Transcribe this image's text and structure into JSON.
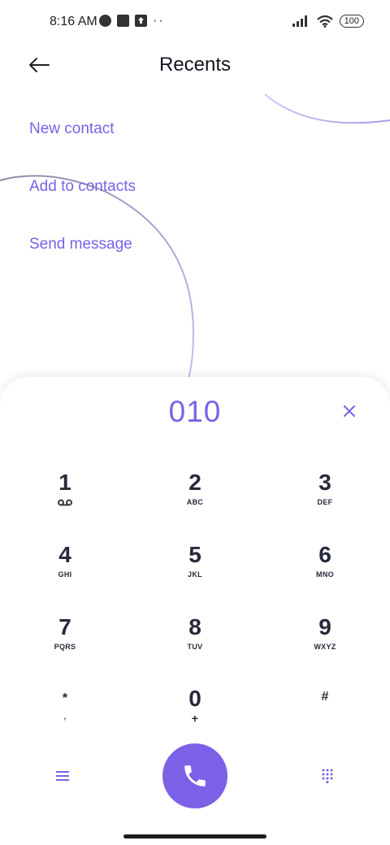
{
  "status_bar": {
    "time": "8:16 AM",
    "battery": "100",
    "icons": [
      "vpn-icon",
      "square-icon",
      "upload-icon",
      "more-dots-icon",
      "signal-icon",
      "wifi-icon",
      "battery-icon"
    ]
  },
  "header": {
    "title": "Recents",
    "back_icon": "back-arrow-icon"
  },
  "actions": [
    {
      "label": "New contact"
    },
    {
      "label": "Add to contacts"
    },
    {
      "label": "Send message"
    }
  ],
  "dialer": {
    "number": "010",
    "clear_icon": "close-icon",
    "keys": [
      {
        "digit": "1",
        "sub": ""
      },
      {
        "digit": "2",
        "sub": "ABC"
      },
      {
        "digit": "3",
        "sub": "DEF"
      },
      {
        "digit": "4",
        "sub": "GHI"
      },
      {
        "digit": "5",
        "sub": "JKL"
      },
      {
        "digit": "6",
        "sub": "MNO"
      },
      {
        "digit": "7",
        "sub": "PQRS"
      },
      {
        "digit": "8",
        "sub": "TUV"
      },
      {
        "digit": "9",
        "sub": "WXYZ"
      },
      {
        "digit": "*",
        "sub": ","
      },
      {
        "digit": "0",
        "sub": "+"
      },
      {
        "digit": "#",
        "sub": ""
      }
    ],
    "bottom": {
      "left_icon": "menu-icon",
      "call_icon": "phone-icon",
      "right_icon": "dialpad-icon"
    }
  },
  "colors": {
    "accent": "#7b61e6",
    "key_text": "#262a3a"
  }
}
